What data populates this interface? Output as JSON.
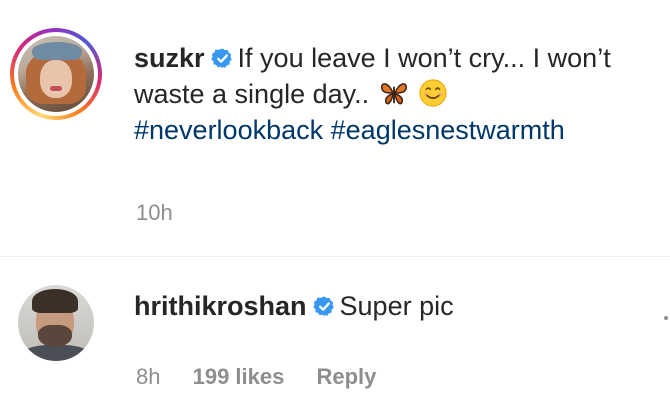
{
  "post": {
    "username": "suzkr",
    "caption_text": "If you leave I won’t cry... I won’t waste a single day..",
    "emojis": [
      "butterfly-emoji",
      "smiling-face-emoji"
    ],
    "hashtags": [
      "#neverlookback",
      "#eaglesnestwarmth"
    ],
    "time": "10h",
    "verified_color": "#3897f0"
  },
  "comment": {
    "username": "hrithikroshan",
    "text": "Super pic",
    "time": "8h",
    "likes": "199 likes",
    "reply_label": "Reply"
  },
  "colors": {
    "text": "#262626",
    "secondary": "#8e8e8e",
    "hashtag": "#00376b",
    "divider": "#efefef"
  }
}
